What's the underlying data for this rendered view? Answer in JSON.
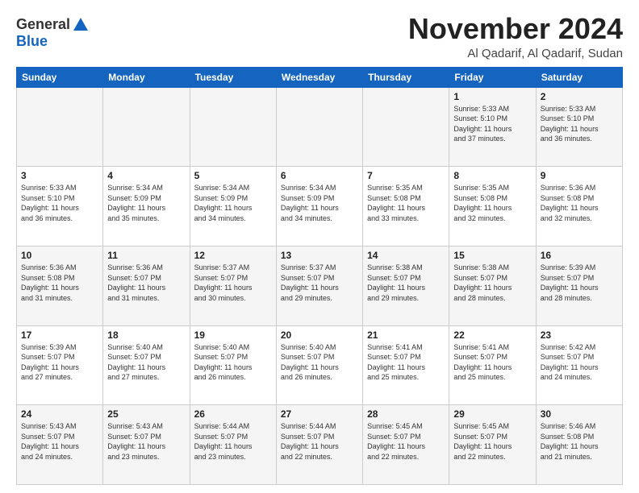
{
  "logo": {
    "general": "General",
    "blue": "Blue"
  },
  "header": {
    "month": "November 2024",
    "location": "Al Qadarif, Al Qadarif, Sudan"
  },
  "weekdays": [
    "Sunday",
    "Monday",
    "Tuesday",
    "Wednesday",
    "Thursday",
    "Friday",
    "Saturday"
  ],
  "weeks": [
    [
      {
        "day": "",
        "info": ""
      },
      {
        "day": "",
        "info": ""
      },
      {
        "day": "",
        "info": ""
      },
      {
        "day": "",
        "info": ""
      },
      {
        "day": "",
        "info": ""
      },
      {
        "day": "1",
        "info": "Sunrise: 5:33 AM\nSunset: 5:10 PM\nDaylight: 11 hours\nand 37 minutes."
      },
      {
        "day": "2",
        "info": "Sunrise: 5:33 AM\nSunset: 5:10 PM\nDaylight: 11 hours\nand 36 minutes."
      }
    ],
    [
      {
        "day": "3",
        "info": "Sunrise: 5:33 AM\nSunset: 5:10 PM\nDaylight: 11 hours\nand 36 minutes."
      },
      {
        "day": "4",
        "info": "Sunrise: 5:34 AM\nSunset: 5:09 PM\nDaylight: 11 hours\nand 35 minutes."
      },
      {
        "day": "5",
        "info": "Sunrise: 5:34 AM\nSunset: 5:09 PM\nDaylight: 11 hours\nand 34 minutes."
      },
      {
        "day": "6",
        "info": "Sunrise: 5:34 AM\nSunset: 5:09 PM\nDaylight: 11 hours\nand 34 minutes."
      },
      {
        "day": "7",
        "info": "Sunrise: 5:35 AM\nSunset: 5:08 PM\nDaylight: 11 hours\nand 33 minutes."
      },
      {
        "day": "8",
        "info": "Sunrise: 5:35 AM\nSunset: 5:08 PM\nDaylight: 11 hours\nand 32 minutes."
      },
      {
        "day": "9",
        "info": "Sunrise: 5:36 AM\nSunset: 5:08 PM\nDaylight: 11 hours\nand 32 minutes."
      }
    ],
    [
      {
        "day": "10",
        "info": "Sunrise: 5:36 AM\nSunset: 5:08 PM\nDaylight: 11 hours\nand 31 minutes."
      },
      {
        "day": "11",
        "info": "Sunrise: 5:36 AM\nSunset: 5:07 PM\nDaylight: 11 hours\nand 31 minutes."
      },
      {
        "day": "12",
        "info": "Sunrise: 5:37 AM\nSunset: 5:07 PM\nDaylight: 11 hours\nand 30 minutes."
      },
      {
        "day": "13",
        "info": "Sunrise: 5:37 AM\nSunset: 5:07 PM\nDaylight: 11 hours\nand 29 minutes."
      },
      {
        "day": "14",
        "info": "Sunrise: 5:38 AM\nSunset: 5:07 PM\nDaylight: 11 hours\nand 29 minutes."
      },
      {
        "day": "15",
        "info": "Sunrise: 5:38 AM\nSunset: 5:07 PM\nDaylight: 11 hours\nand 28 minutes."
      },
      {
        "day": "16",
        "info": "Sunrise: 5:39 AM\nSunset: 5:07 PM\nDaylight: 11 hours\nand 28 minutes."
      }
    ],
    [
      {
        "day": "17",
        "info": "Sunrise: 5:39 AM\nSunset: 5:07 PM\nDaylight: 11 hours\nand 27 minutes."
      },
      {
        "day": "18",
        "info": "Sunrise: 5:40 AM\nSunset: 5:07 PM\nDaylight: 11 hours\nand 27 minutes."
      },
      {
        "day": "19",
        "info": "Sunrise: 5:40 AM\nSunset: 5:07 PM\nDaylight: 11 hours\nand 26 minutes."
      },
      {
        "day": "20",
        "info": "Sunrise: 5:40 AM\nSunset: 5:07 PM\nDaylight: 11 hours\nand 26 minutes."
      },
      {
        "day": "21",
        "info": "Sunrise: 5:41 AM\nSunset: 5:07 PM\nDaylight: 11 hours\nand 25 minutes."
      },
      {
        "day": "22",
        "info": "Sunrise: 5:41 AM\nSunset: 5:07 PM\nDaylight: 11 hours\nand 25 minutes."
      },
      {
        "day": "23",
        "info": "Sunrise: 5:42 AM\nSunset: 5:07 PM\nDaylight: 11 hours\nand 24 minutes."
      }
    ],
    [
      {
        "day": "24",
        "info": "Sunrise: 5:43 AM\nSunset: 5:07 PM\nDaylight: 11 hours\nand 24 minutes."
      },
      {
        "day": "25",
        "info": "Sunrise: 5:43 AM\nSunset: 5:07 PM\nDaylight: 11 hours\nand 23 minutes."
      },
      {
        "day": "26",
        "info": "Sunrise: 5:44 AM\nSunset: 5:07 PM\nDaylight: 11 hours\nand 23 minutes."
      },
      {
        "day": "27",
        "info": "Sunrise: 5:44 AM\nSunset: 5:07 PM\nDaylight: 11 hours\nand 22 minutes."
      },
      {
        "day": "28",
        "info": "Sunrise: 5:45 AM\nSunset: 5:07 PM\nDaylight: 11 hours\nand 22 minutes."
      },
      {
        "day": "29",
        "info": "Sunrise: 5:45 AM\nSunset: 5:07 PM\nDaylight: 11 hours\nand 22 minutes."
      },
      {
        "day": "30",
        "info": "Sunrise: 5:46 AM\nSunset: 5:08 PM\nDaylight: 11 hours\nand 21 minutes."
      }
    ]
  ]
}
